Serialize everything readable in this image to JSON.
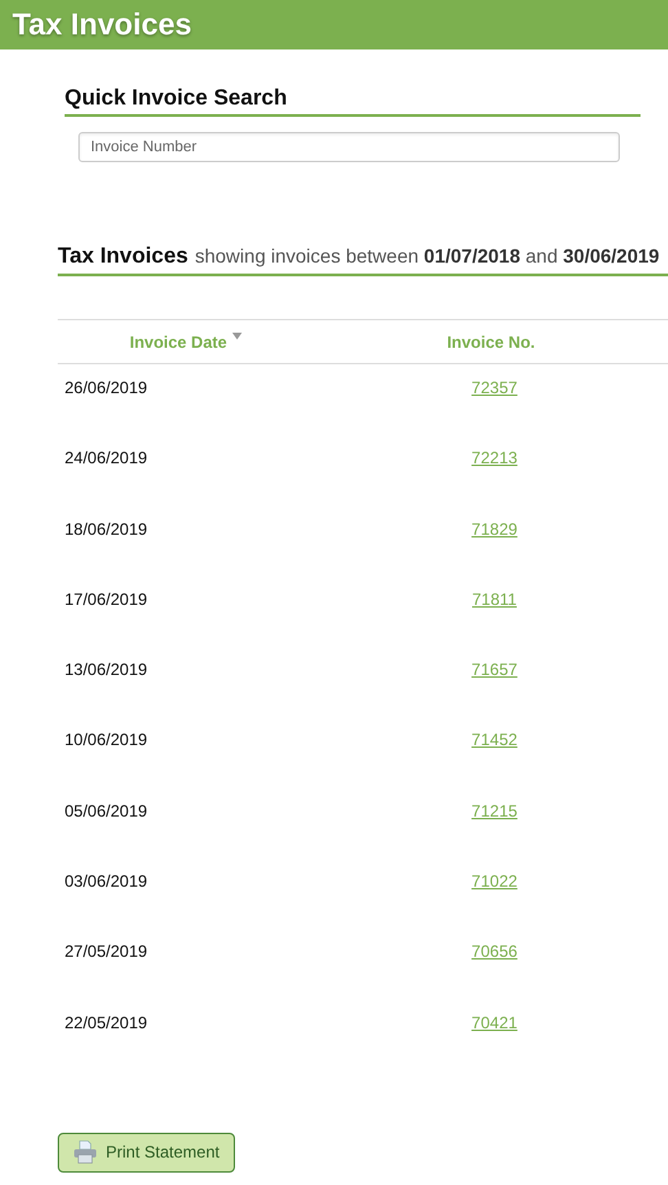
{
  "header": {
    "title": "Tax Invoices"
  },
  "quick_search": {
    "title": "Quick Invoice Search",
    "placeholder": "Invoice Number"
  },
  "invoices": {
    "title": "Tax Invoices",
    "subtitle": "showing invoices between **01/07/2018** and **30/06/2019**",
    "columns": [
      {
        "label": "Invoice Date",
        "sorted": true
      },
      {
        "label": "Invoice No.",
        "sorted": false
      }
    ],
    "rows": [
      {
        "date": "26/06/2019",
        "number": "72357"
      },
      {
        "date": "24/06/2019",
        "number": "72213"
      },
      {
        "date": "18/06/2019",
        "number": "71829"
      },
      {
        "date": "17/06/2019",
        "number": "71811"
      },
      {
        "date": "13/06/2019",
        "number": "71657"
      },
      {
        "date": "10/06/2019",
        "number": "71452"
      },
      {
        "date": "05/06/2019",
        "number": "71215"
      },
      {
        "date": "03/06/2019",
        "number": "71022"
      },
      {
        "date": "27/05/2019",
        "number": "70656"
      },
      {
        "date": "22/05/2019",
        "number": "70421"
      }
    ]
  },
  "buttons": [
    {
      "label": "Print Statement"
    }
  ]
}
